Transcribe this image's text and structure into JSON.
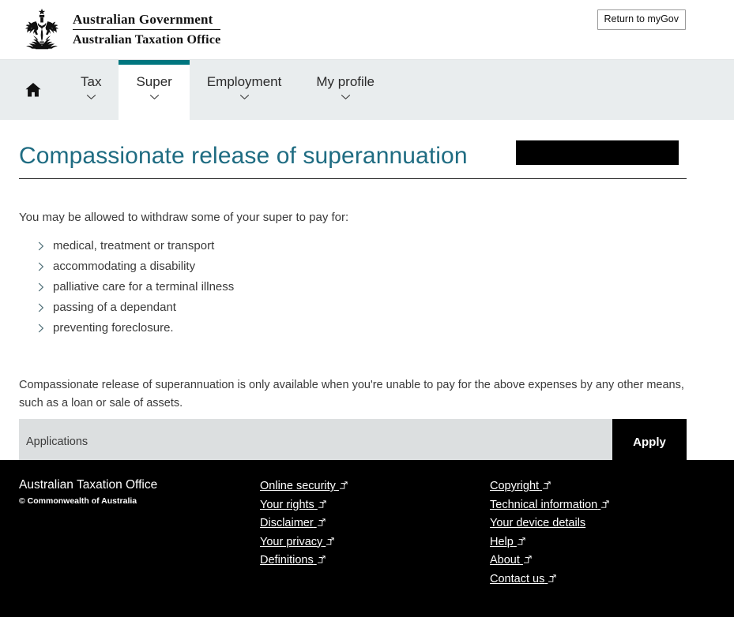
{
  "masthead": {
    "crest_alt": "australian-coat-of-arms",
    "line1": "Australian Government",
    "line2": "Australian Taxation Office",
    "return_button": "Return to myGov"
  },
  "nav": {
    "accent_color": "#00767f",
    "background": "#e9edee",
    "home_icon": "home-icon",
    "items": [
      {
        "label": "Tax",
        "active": false,
        "has_chevron": true
      },
      {
        "label": "Super",
        "active": true,
        "has_chevron": true
      },
      {
        "label": "Employment",
        "active": false,
        "has_chevron": true
      },
      {
        "label": "My profile",
        "active": false,
        "has_chevron": true
      }
    ],
    "redacted_block": ""
  },
  "page": {
    "title": "Compassionate release of superannuation",
    "title_color": "#1f6c82",
    "lead": "You may be allowed to withdraw some of your super to pay for:",
    "reasons": [
      "medical, treatment or transport",
      "accommodating a disability",
      "palliative care for a terminal illness",
      "passing of a dependant",
      "preventing foreclosure."
    ],
    "note": "Compassionate release of superannuation is only available when you're unable to pay for the above expenses by any other means, such as a loan or sale of assets."
  },
  "applications": {
    "label": "Applications",
    "apply_button": "Apply",
    "bar_color": "#dcdfe0",
    "button_color": "#000000"
  },
  "footer": {
    "org": "Australian Taxation Office",
    "copyright": "© Commonwealth of Australia",
    "column1": [
      {
        "label": "Online security",
        "external": true
      },
      {
        "label": "Your rights",
        "external": true
      },
      {
        "label": "Disclaimer",
        "external": true
      },
      {
        "label": "Your privacy",
        "external": true
      },
      {
        "label": "Definitions",
        "external": true
      }
    ],
    "column2": [
      {
        "label": "Copyright",
        "external": true
      },
      {
        "label": "Technical information",
        "external": true
      },
      {
        "label": "Your device details",
        "external": false
      },
      {
        "label": "Help",
        "external": true
      },
      {
        "label": "About",
        "external": true
      },
      {
        "label": "Contact us",
        "external": true
      }
    ]
  }
}
